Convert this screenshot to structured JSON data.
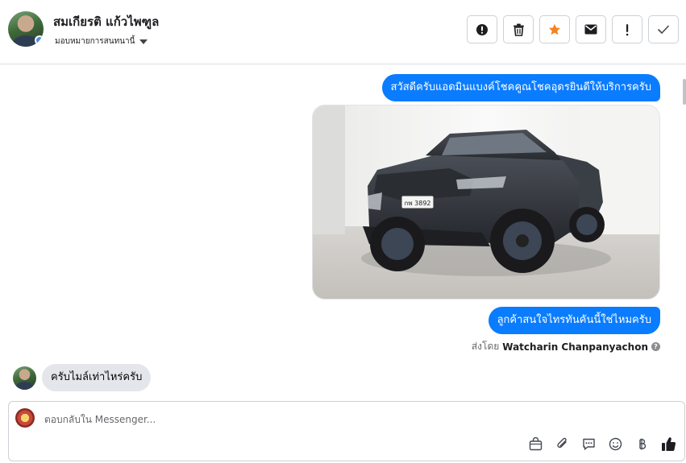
{
  "header": {
    "contact_name": "สมเกียรติ แก้วไพฑูล",
    "assign_label": "มอบหมายการสนทนานี้",
    "actions": [
      {
        "name": "spam-button",
        "icon": "alert-circle-icon"
      },
      {
        "name": "delete-button",
        "icon": "trash-icon"
      },
      {
        "name": "star-button",
        "icon": "star-icon"
      },
      {
        "name": "mark-unread-button",
        "icon": "envelope-icon"
      },
      {
        "name": "follow-up-button",
        "icon": "exclamation-icon"
      },
      {
        "name": "mark-done-button",
        "icon": "check-icon"
      }
    ],
    "star_color": "#f5821f"
  },
  "conversation": {
    "outgoing_1": "สวัสดีครับแอดมินแบงค์โชคคูณโชคอุดรยินดีให้บริการครับ",
    "photo": {
      "alt": "Dark gray pickup truck in showroom",
      "plate": "กพ 3892"
    },
    "outgoing_2": "ลูกค้าสนใจไทรทันคันนี้ใช่ไหมครับ",
    "sent_by_prefix": "ส่งโดย",
    "sent_by_name": "Watcharin Chanpanyachon",
    "incoming_1": "ครับไมล์เท่าไหร่ครับ"
  },
  "composer": {
    "placeholder": "ตอบกลับใน Messenger...",
    "tools": [
      "bag-icon",
      "paperclip-icon",
      "saved-reply-icon",
      "emoji-icon",
      "baht-icon",
      "like-icon"
    ]
  },
  "colors": {
    "outgoing_bubble": "#0a7cff",
    "incoming_bubble": "#e4e6eb"
  }
}
